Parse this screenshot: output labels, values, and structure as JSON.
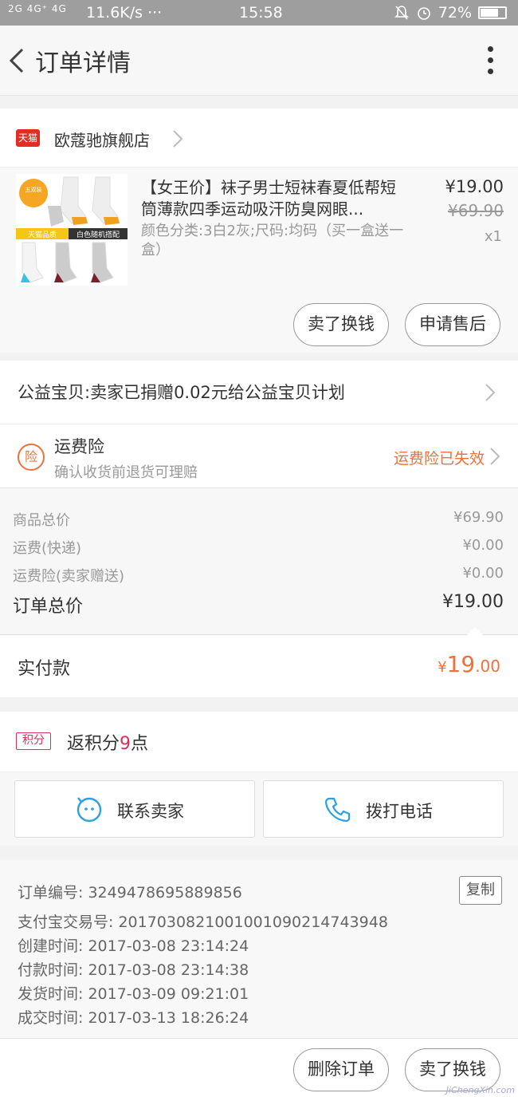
{
  "status_bar": {
    "signal": "2G 4G⁺ 4G",
    "speed": "11.6K/s ···",
    "time": "15:58",
    "battery": "72%",
    "battery_level": 0.72
  },
  "header": {
    "title": "订单详情"
  },
  "store": {
    "badge": "天猫",
    "name": "欧蔻驰旗舰店"
  },
  "product": {
    "thumb_top_text": "五双装",
    "thumb_tag_left": "天猫品质",
    "thumb_tag_right": "白色随机搭配",
    "title": "【女王价】袜子男士短袜春夏低帮短筒薄款四季运动吸汗防臭网眼...",
    "spec": "颜色分类:3白2灰;尺码:均码（买一盒送一盒）",
    "price": "¥19.00",
    "original_price": "¥69.90",
    "quantity": "x1",
    "btn_sell": "卖了换钱",
    "btn_after_sale": "申请售后"
  },
  "charity": {
    "text": "公益宝贝:卖家已捐赠0.02元给公益宝贝计划"
  },
  "insurance": {
    "icon_text": "险",
    "title": "运费险",
    "subtitle": "确认收货前退货可理赔",
    "status": "运费险已失效"
  },
  "summary": {
    "rows": [
      {
        "label": "商品总价",
        "value": "¥69.90"
      },
      {
        "label": "运费(快递)",
        "value": "¥0.00"
      },
      {
        "label": "运费险(卖家赠送)",
        "value": "¥0.00"
      }
    ],
    "total_label": "订单总价",
    "total_value": "¥19.00"
  },
  "paid": {
    "label": "实付款",
    "currency": "¥",
    "integer": "19",
    "decimal": ".00"
  },
  "points": {
    "badge": "积分",
    "prefix": "返积分",
    "number": "9",
    "suffix": "点"
  },
  "contact": {
    "seller": "联系卖家",
    "phone": "拨打电话"
  },
  "order_info": {
    "copy_label": "复制",
    "lines": [
      "订单编号: 3249478695889856",
      "支付宝交易号: 2017030821001001090214743948",
      "创建时间: 2017-03-08 23:14:24",
      "付款时间: 2017-03-08 23:14:38",
      "发货时间: 2017-03-09 09:21:01",
      "成交时间: 2017-03-13 18:26:24"
    ]
  },
  "bottom": {
    "delete": "删除订单",
    "sell": "卖了换钱"
  },
  "watermark": "JiChengXin.com",
  "colors": {
    "accent": "#f0703a",
    "tmall": "#e02e24",
    "points": "#e02e5a",
    "contact_icon": "#2aa1e0"
  }
}
